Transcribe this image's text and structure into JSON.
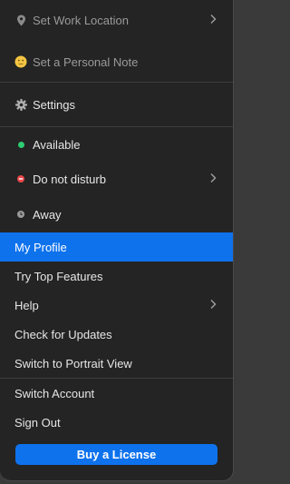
{
  "menu": {
    "set_work_location": "Set Work Location",
    "set_personal_note": "Set a Personal Note",
    "settings": "Settings",
    "status": {
      "available": "Available",
      "do_not_disturb": "Do not disturb",
      "away": "Away"
    },
    "my_profile": "My Profile",
    "try_top_features": "Try Top Features",
    "help": "Help",
    "check_for_updates": "Check for Updates",
    "switch_to_portrait": "Switch to Portrait View",
    "switch_account": "Switch Account",
    "sign_out": "Sign Out",
    "buy_license": "Buy a License"
  },
  "colors": {
    "accent": "#0e72ed",
    "available": "#2ecc71",
    "dnd": "#e8474a",
    "away": "#9a9a9a"
  }
}
